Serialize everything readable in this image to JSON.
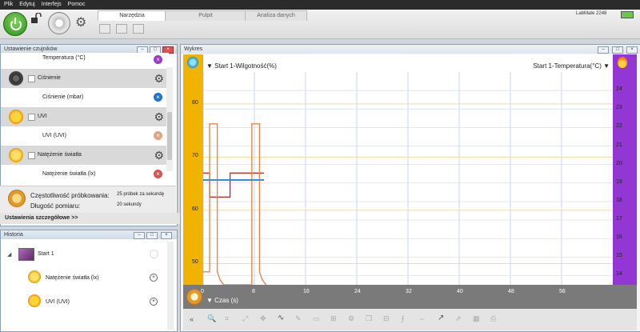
{
  "menu": [
    "Plik",
    "Edytuj",
    "Interfejs",
    "Pomoc"
  ],
  "tabs": [
    "Narzędzia",
    "Pulpit",
    "Analiza danych"
  ],
  "device": "LabMate 2248",
  "sensors_panel": {
    "title": "Ustawienie czujników",
    "rows": [
      {
        "label": "Temperatura (°C)"
      },
      {
        "label": "Ciśnienie"
      },
      {
        "label": "Ciśnienie (mbar)"
      },
      {
        "label": "UVI"
      },
      {
        "label": "UVI (UVI)"
      },
      {
        "label": "Natężenie światła"
      },
      {
        "label": "Natężenie światła (lx)"
      }
    ],
    "freq_label": "Częstotliwość próbkowania:",
    "freq_value": "25 próbek za sekundę",
    "dur_label": "Długość pomiaru:",
    "dur_value": "20 sekundy",
    "advanced": "Ustawienia szczegółowe >>"
  },
  "history_panel": {
    "title": "Historia",
    "items": [
      {
        "label": "Start 1"
      },
      {
        "label": "Natężenie światła (lx)"
      },
      {
        "label": "UVI (UVI)"
      }
    ]
  },
  "graph": {
    "title": "Wykres",
    "left_series": "Start 1-Wilgotność(%)",
    "right_series": "Start 1-Temperatura(°C)",
    "x_label": "Czas (s)",
    "colors": {
      "left_axis": "#f0b400",
      "right_axis": "#9237d3",
      "humidity": "#b5382c",
      "temperature": "#e8864a"
    }
  },
  "chart_data": {
    "type": "line",
    "x_ticks": [
      0,
      8,
      16,
      24,
      32,
      40,
      48,
      56
    ],
    "y_left_ticks": [
      50,
      60,
      70,
      80
    ],
    "y_right_ticks": [
      14,
      15,
      16,
      17,
      18,
      19,
      20,
      21,
      22,
      23,
      24
    ],
    "xlabel": "Czas (s)",
    "xlim": [
      0,
      64
    ],
    "ylim_left": [
      46,
      86
    ],
    "ylim_right": [
      13.5,
      25
    ],
    "series": [
      {
        "name": "Start 1-Wilgotność(%)",
        "axis": "left",
        "x": [
          0,
          1,
          1,
          4.2,
          4.2,
          9.5
        ],
        "y": [
          67,
          67,
          62.5,
          62.5,
          67,
          67
        ]
      },
      {
        "name": "Start 1-Temperatura(°C)",
        "axis": "right",
        "x": [
          0,
          1,
          1,
          2.2,
          2.2,
          2.6,
          3.2,
          7.6,
          7.6,
          8.8,
          8.8,
          9.2,
          9.8
        ],
        "y": [
          14.2,
          14.2,
          22.2,
          22.2,
          14.2,
          13.8,
          13.5,
          13.5,
          22.2,
          22.2,
          14.2,
          13.8,
          13.5
        ]
      },
      {
        "axis": "left",
        "x": [
          0,
          9.5
        ],
        "y": [
          65.7,
          65.7
        ]
      }
    ]
  }
}
